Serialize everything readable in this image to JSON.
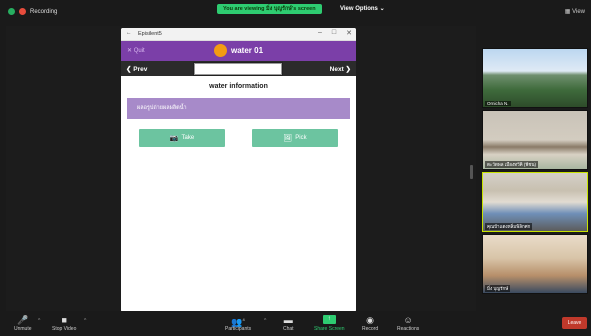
{
  "top": {
    "recording": "Recording",
    "viewing_banner": "You are viewing มิ่ง บุญรักษ์'s screen",
    "view_options": "View Options ⌄",
    "view": "View"
  },
  "app_window": {
    "title": "Episilent5",
    "back_icon": "←",
    "minimize": "–",
    "maximize": "□",
    "close": "✕",
    "quit": "✕ Quit",
    "logo_text": "",
    "app_title": "water 01",
    "prev": "❮ Prev",
    "next": "Next ❯",
    "nav_input_value": "",
    "section_title": "water information",
    "banner_text": "ผลอรูปถ่ายผลผลิตน้ำ",
    "take_label": "Take",
    "take_icon": "📷",
    "pick_label": "Pick",
    "pick_icon": "🖼"
  },
  "participants": [
    {
      "name": "Ornicha N."
    },
    {
      "name": "ตะวัดพล เมืองทวีคิ (พีชน)"
    },
    {
      "name": "คุณป้าแตงหลิ่มพิลิกศก"
    },
    {
      "name": "มิ่ง บุญรักษ์"
    }
  ],
  "toolbar": {
    "unmute": "Unmute",
    "stop_video": "Stop Video",
    "participants": "Participants",
    "participants_count": "4",
    "chat": "Chat",
    "share_screen": "Share Screen",
    "record": "Record",
    "reactions": "Reactions",
    "leave": "Leave"
  }
}
